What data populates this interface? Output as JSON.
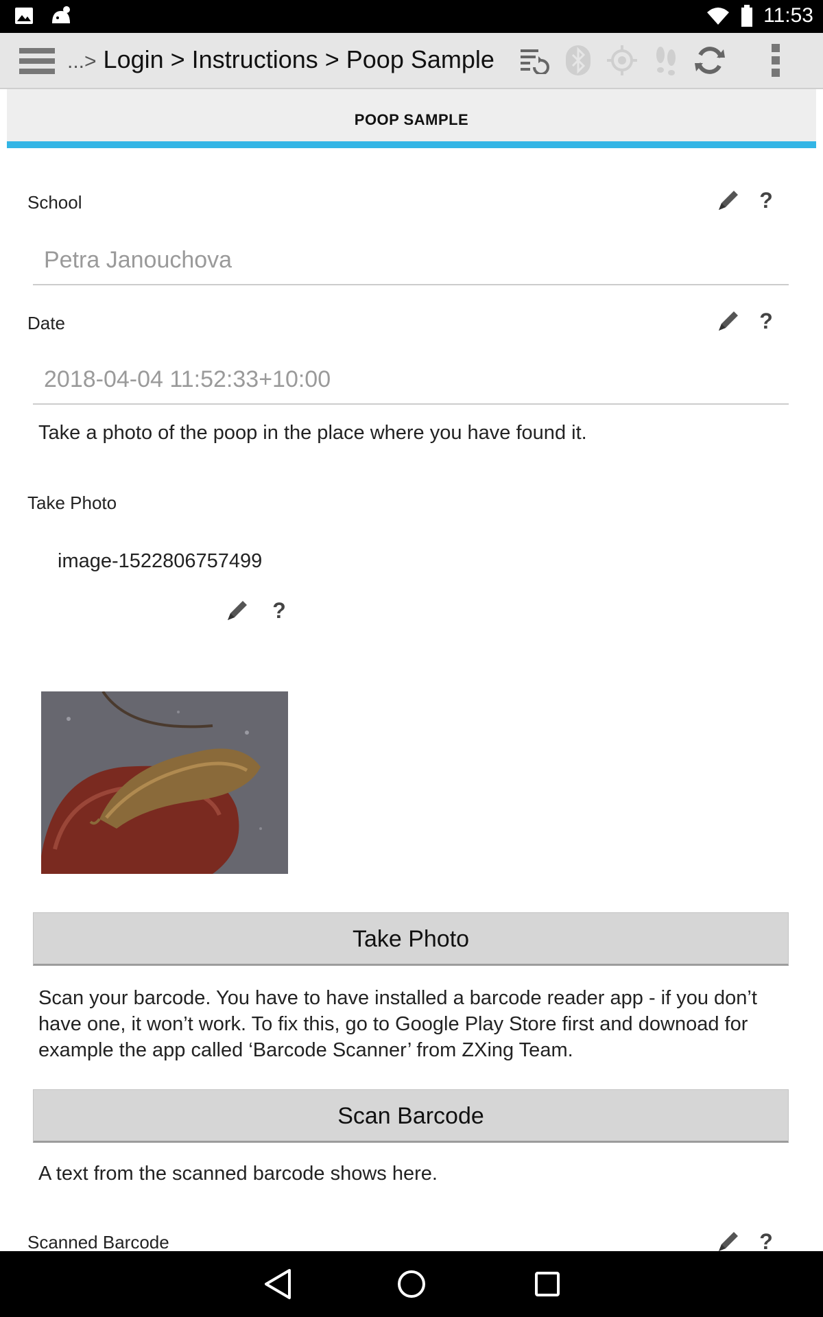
{
  "status_bar": {
    "time": "11:53"
  },
  "app_bar": {
    "breadcrumb_prefix": "...>",
    "breadcrumb": "Login > Instructions > Poop Sample"
  },
  "tab": {
    "title": "POOP SAMPLE"
  },
  "form": {
    "school": {
      "label": "School",
      "value": "Petra Janouchova"
    },
    "date": {
      "label": "Date",
      "value": "2018-04-04 11:52:33+10:00"
    },
    "photo_instruction": "Take a photo of the poop in the place where you have found it.",
    "take_photo": {
      "label": "Take Photo",
      "filename": "image-1522806757499",
      "button_label": "Take Photo"
    },
    "scan_instruction": "Scan your barcode. You have to have installed a barcode reader app - if you don’t have one, it won’t work. To fix this, go to Google Play Store first and downoad for example the app called ‘Barcode Scanner’ from ZXing Team.",
    "scan_button_label": "Scan Barcode",
    "scan_result_note": "A text from the scanned barcode shows here.",
    "scanned_barcode": {
      "label": "Scanned Barcode"
    }
  },
  "colors": {
    "accent": "#33b5e5",
    "app_bar": "#e6e6e6",
    "button": "#d6d6d6"
  },
  "icons": [
    "gallery-icon",
    "android-icon",
    "wifi-icon",
    "battery-icon",
    "menu-icon",
    "sync-list-icon",
    "bluetooth-icon",
    "gps-icon",
    "footsteps-icon",
    "refresh-icon",
    "overflow-icon",
    "pencil-icon",
    "help-icon",
    "back-icon",
    "home-icon",
    "recents-icon"
  ]
}
